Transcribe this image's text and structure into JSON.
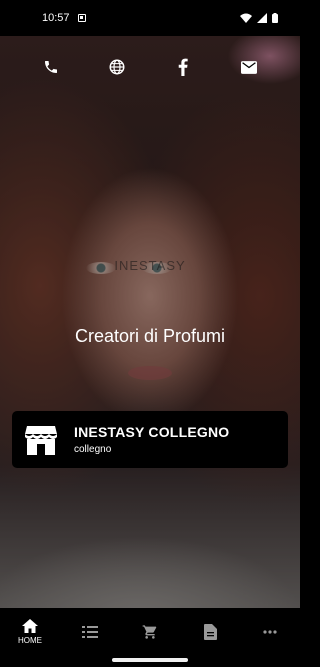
{
  "status_bar": {
    "time": "10:57"
  },
  "contacts": [
    {
      "icon": "phone-icon"
    },
    {
      "icon": "globe-icon"
    },
    {
      "icon": "facebook-icon"
    },
    {
      "icon": "mail-icon"
    }
  ],
  "hero": {
    "watermark": "INESTASY",
    "headline": "Creatori di Profumi"
  },
  "store_card": {
    "name": "INESTASY COLLEGNO",
    "subtitle": "collegno",
    "icon": "store-icon"
  },
  "bottom_nav": {
    "items": [
      {
        "label": "HOME",
        "icon": "home-icon",
        "active": true
      },
      {
        "label": "",
        "icon": "list-icon"
      },
      {
        "label": "",
        "icon": "cart-icon"
      },
      {
        "label": "",
        "icon": "document-icon"
      },
      {
        "label": "",
        "icon": "more-icon"
      }
    ]
  },
  "colors": {
    "background": "#000000",
    "text": "#ffffff"
  }
}
